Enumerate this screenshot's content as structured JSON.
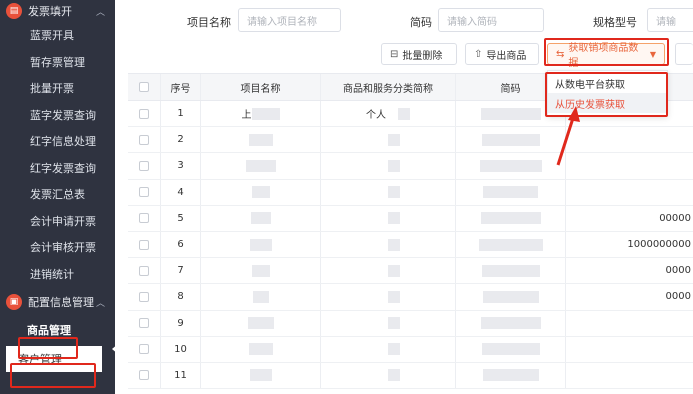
{
  "sidebar": {
    "group1": {
      "label": "发票填开",
      "icon": "invoice-icon"
    },
    "items": [
      {
        "label": "蓝票开具"
      },
      {
        "label": "暂存票管理"
      },
      {
        "label": "批量开票"
      },
      {
        "label": "蓝字发票查询"
      },
      {
        "label": "红字信息处理"
      },
      {
        "label": "红字发票查询"
      },
      {
        "label": "发票汇总表"
      },
      {
        "label": "会计申请开票"
      },
      {
        "label": "会计审核开票"
      },
      {
        "label": "进销统计"
      }
    ],
    "group2": {
      "label": "配置信息管理",
      "icon": "config-icon"
    },
    "sub_items": [
      {
        "label": "商品管理"
      },
      {
        "label": "客户管理"
      }
    ]
  },
  "filters": {
    "name_label": "项目名称",
    "name_placeholder": "请输入项目名称",
    "code_label": "简码",
    "code_placeholder": "请输入简码",
    "spec_label": "规格型号",
    "spec_placeholder": "请输"
  },
  "toolbar": {
    "batch_delete": "批量删除",
    "export": "导出商品",
    "fetch": "获取销项商品数据"
  },
  "dropdown": {
    "items": [
      "从数电平台获取",
      "从历史发票获取"
    ]
  },
  "table": {
    "headers": [
      "序号",
      "项目名称",
      "商品和服务分类简称",
      "简码"
    ],
    "rows": [
      {
        "no": "1",
        "name": "上",
        "cat": "个人",
        "rest": ""
      },
      {
        "no": "2",
        "name": "",
        "cat": "",
        "rest": ""
      },
      {
        "no": "3",
        "name": "",
        "cat": "",
        "rest": ""
      },
      {
        "no": "4",
        "name": "",
        "cat": "",
        "rest": ""
      },
      {
        "no": "5",
        "name": "",
        "cat": "",
        "rest": "00000"
      },
      {
        "no": "6",
        "name": "",
        "cat": "",
        "rest": "1000000000"
      },
      {
        "no": "7",
        "name": "",
        "cat": "",
        "rest": "0000"
      },
      {
        "no": "8",
        "name": "",
        "cat": "",
        "rest": "0000"
      },
      {
        "no": "9",
        "name": "",
        "cat": "",
        "rest": ""
      },
      {
        "no": "10",
        "name": "",
        "cat": "",
        "rest": ""
      },
      {
        "no": "11",
        "name": "",
        "cat": "",
        "rest": ""
      }
    ]
  },
  "colors": {
    "accent": "#e8513b",
    "highlight": "#e0281c",
    "sidebar": "#2f3340"
  }
}
